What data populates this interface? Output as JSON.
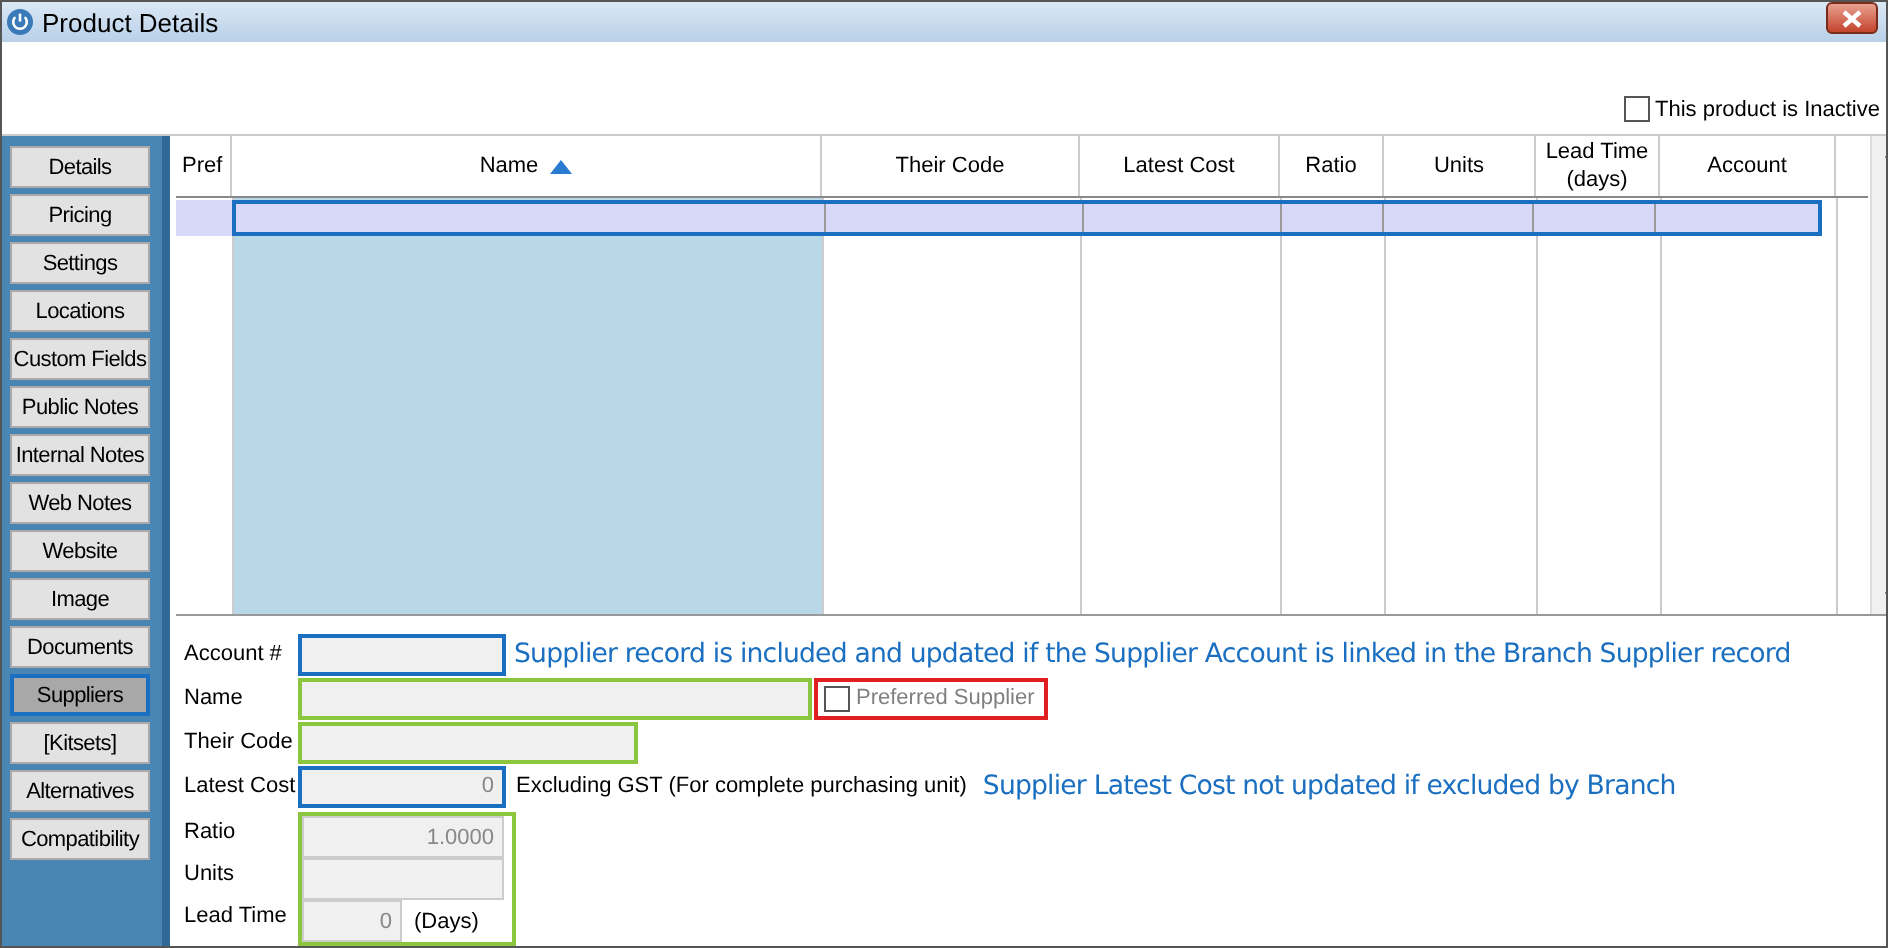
{
  "window": {
    "title": "Product Details"
  },
  "inactive": {
    "label": "This product is Inactive",
    "checked": false
  },
  "sidebar": {
    "items": [
      {
        "label": "Details",
        "selected": false
      },
      {
        "label": "Pricing",
        "selected": false
      },
      {
        "label": "Settings",
        "selected": false
      },
      {
        "label": "Locations",
        "selected": false
      },
      {
        "label": "Custom Fields",
        "selected": false
      },
      {
        "label": "Public Notes",
        "selected": false
      },
      {
        "label": "Internal Notes",
        "selected": false
      },
      {
        "label": "Web Notes",
        "selected": false
      },
      {
        "label": "Website",
        "selected": false
      },
      {
        "label": "Image",
        "selected": false
      },
      {
        "label": "Documents",
        "selected": false
      },
      {
        "label": "Suppliers",
        "selected": true
      },
      {
        "label": "[Kitsets]",
        "selected": false
      },
      {
        "label": "Alternatives",
        "selected": false
      },
      {
        "label": "Compatibility",
        "selected": false
      }
    ]
  },
  "table": {
    "columns": [
      {
        "label": "Pref",
        "sorted": false
      },
      {
        "label": "Name",
        "sorted": true
      },
      {
        "label": "Their Code",
        "sorted": false
      },
      {
        "label": "Latest Cost",
        "sorted": false
      },
      {
        "label": "Ratio",
        "sorted": false
      },
      {
        "label": "Units",
        "sorted": false
      },
      {
        "label": "Lead Time\n(days)",
        "sorted": false
      },
      {
        "label": "Account",
        "sorted": false
      }
    ]
  },
  "form": {
    "account": {
      "label": "Account #"
    },
    "account_note": "Supplier record is included and updated if the Supplier Account is linked in the Branch Supplier record",
    "name": {
      "label": "Name"
    },
    "preferred": {
      "label": "Preferred Supplier",
      "checked": false,
      "disabled": true
    },
    "their_code": {
      "label": "Their Code"
    },
    "latest_cost": {
      "label": "Latest Cost",
      "value": "0"
    },
    "latest_cost_hint": "Excluding GST (For complete purchasing unit)",
    "latest_cost_note": "Supplier Latest Cost not updated if excluded by Branch",
    "ratio": {
      "label": "Ratio",
      "value": "1.0000"
    },
    "units": {
      "label": "Units"
    },
    "lead_time": {
      "label": "Lead Time",
      "value": "0",
      "unit": "(Days)"
    }
  }
}
